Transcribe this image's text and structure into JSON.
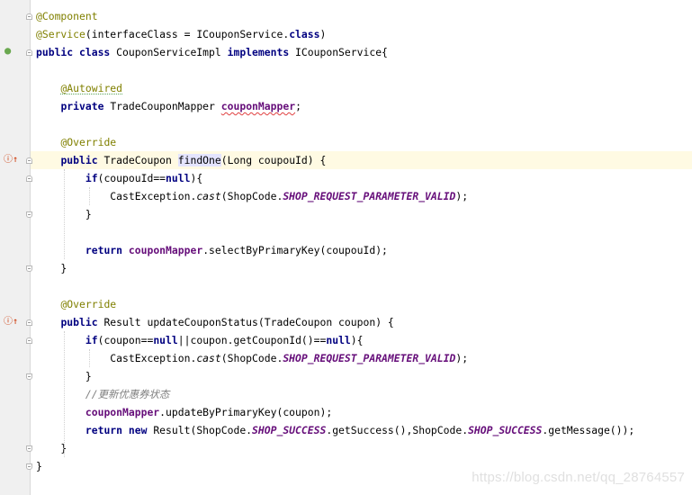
{
  "colors": {
    "keyword": "#000080",
    "annotation": "#808000",
    "field": "#660e7a",
    "static_const": "#660e7a",
    "comment": "#808080",
    "default": "#000000",
    "current_line_bg": "#fffae3",
    "highlight_bg": "#e4e4ff"
  },
  "gutter_icons": [
    {
      "line": 3,
      "name": "spring-bean-icon",
      "glyph": "●",
      "color": "#6aa84f"
    },
    {
      "line": 9,
      "name": "implementing-method-icon",
      "glyph": "ⓘ↑",
      "color": "#cc3300"
    },
    {
      "line": 18,
      "name": "implementing-method-icon",
      "glyph": "ⓘ↑",
      "color": "#cc3300"
    }
  ],
  "code_lines": [
    {
      "tokens": [
        {
          "t": "@Component",
          "s": "annotation"
        }
      ]
    },
    {
      "tokens": [
        {
          "t": "@Service",
          "s": "annotation"
        },
        {
          "t": "(interfaceClass = ICouponService.",
          "s": "default"
        },
        {
          "t": "class",
          "s": "keyword"
        },
        {
          "t": ")",
          "s": "default"
        }
      ]
    },
    {
      "tokens": [
        {
          "t": "public class ",
          "s": "keyword"
        },
        {
          "t": "CouponServiceImpl ",
          "s": "default"
        },
        {
          "t": "implements ",
          "s": "keyword"
        },
        {
          "t": "ICouponService{",
          "s": "default"
        }
      ]
    },
    {
      "tokens": []
    },
    {
      "tokens": [
        {
          "t": "    ",
          "s": "default"
        },
        {
          "t": "@Autowired",
          "s": "annotation",
          "deco": "green"
        }
      ]
    },
    {
      "tokens": [
        {
          "t": "    ",
          "s": "default"
        },
        {
          "t": "private ",
          "s": "keyword"
        },
        {
          "t": "TradeCouponMapper ",
          "s": "default"
        },
        {
          "t": "couponMapper",
          "s": "field",
          "deco": "red"
        },
        {
          "t": ";",
          "s": "default"
        }
      ]
    },
    {
      "tokens": []
    },
    {
      "tokens": [
        {
          "t": "    ",
          "s": "default"
        },
        {
          "t": "@Override",
          "s": "annotation"
        }
      ]
    },
    {
      "current": true,
      "tokens": [
        {
          "t": "    ",
          "s": "default"
        },
        {
          "t": "public ",
          "s": "keyword"
        },
        {
          "t": "TradeCoupon ",
          "s": "default"
        },
        {
          "t": "findOne",
          "s": "default",
          "bg": "highlight"
        },
        {
          "t": "(Long coupouId) {",
          "s": "default"
        }
      ]
    },
    {
      "tokens": [
        {
          "t": "        ",
          "s": "default"
        },
        {
          "t": "if",
          "s": "keyword"
        },
        {
          "t": "(coupouId==",
          "s": "default"
        },
        {
          "t": "null",
          "s": "keyword"
        },
        {
          "t": "){",
          "s": "default"
        }
      ]
    },
    {
      "tokens": [
        {
          "t": "            CastException.",
          "s": "default"
        },
        {
          "t": "cast",
          "s": "italic"
        },
        {
          "t": "(ShopCode.",
          "s": "default"
        },
        {
          "t": "SHOP_REQUEST_PARAMETER_VALID",
          "s": "static_const"
        },
        {
          "t": ");",
          "s": "default"
        }
      ]
    },
    {
      "tokens": [
        {
          "t": "        }",
          "s": "default"
        }
      ]
    },
    {
      "tokens": []
    },
    {
      "tokens": [
        {
          "t": "        ",
          "s": "default"
        },
        {
          "t": "return ",
          "s": "keyword"
        },
        {
          "t": "couponMapper",
          "s": "field"
        },
        {
          "t": ".selectByPrimaryKey(coupouId);",
          "s": "default"
        }
      ]
    },
    {
      "tokens": [
        {
          "t": "    }",
          "s": "default"
        }
      ]
    },
    {
      "tokens": []
    },
    {
      "tokens": [
        {
          "t": "    ",
          "s": "default"
        },
        {
          "t": "@Override",
          "s": "annotation"
        }
      ]
    },
    {
      "tokens": [
        {
          "t": "    ",
          "s": "default"
        },
        {
          "t": "public ",
          "s": "keyword"
        },
        {
          "t": "Result updateCouponStatus(TradeCoupon coupon) {",
          "s": "default"
        }
      ]
    },
    {
      "tokens": [
        {
          "t": "        ",
          "s": "default"
        },
        {
          "t": "if",
          "s": "keyword"
        },
        {
          "t": "(coupon==",
          "s": "default"
        },
        {
          "t": "null",
          "s": "keyword"
        },
        {
          "t": "||coupon.getCouponId()==",
          "s": "default"
        },
        {
          "t": "null",
          "s": "keyword"
        },
        {
          "t": "){",
          "s": "default"
        }
      ]
    },
    {
      "tokens": [
        {
          "t": "            CastException.",
          "s": "default"
        },
        {
          "t": "cast",
          "s": "italic"
        },
        {
          "t": "(ShopCode.",
          "s": "default"
        },
        {
          "t": "SHOP_REQUEST_PARAMETER_VALID",
          "s": "static_const"
        },
        {
          "t": ");",
          "s": "default"
        }
      ]
    },
    {
      "tokens": [
        {
          "t": "        }",
          "s": "default"
        }
      ]
    },
    {
      "tokens": [
        {
          "t": "        ",
          "s": "default"
        },
        {
          "t": "//更新优惠券状态",
          "s": "comment"
        }
      ]
    },
    {
      "tokens": [
        {
          "t": "        ",
          "s": "default"
        },
        {
          "t": "couponMapper",
          "s": "field"
        },
        {
          "t": ".updateByPrimaryKey(coupon);",
          "s": "default"
        }
      ]
    },
    {
      "tokens": [
        {
          "t": "        ",
          "s": "default"
        },
        {
          "t": "return new ",
          "s": "keyword"
        },
        {
          "t": "Result(ShopCode.",
          "s": "default"
        },
        {
          "t": "SHOP_SUCCESS",
          "s": "static_const"
        },
        {
          "t": ".getSuccess(),ShopCode.",
          "s": "default"
        },
        {
          "t": "SHOP_SUCCESS",
          "s": "static_const"
        },
        {
          "t": ".getMessage());",
          "s": "default"
        }
      ]
    },
    {
      "tokens": [
        {
          "t": "    }",
          "s": "default"
        }
      ]
    },
    {
      "tokens": [
        {
          "t": "}",
          "s": "default"
        }
      ]
    }
  ],
  "watermark": "https://blog.csdn.net/qq_28764557"
}
